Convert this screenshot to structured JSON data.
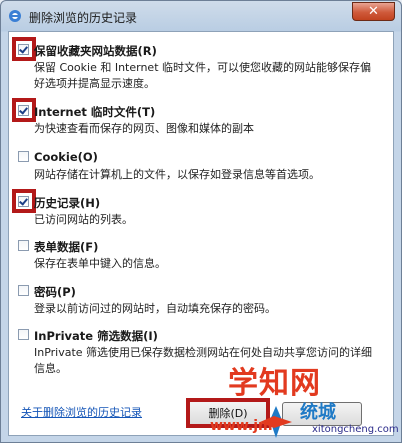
{
  "window": {
    "title": "删除浏览的历史记录",
    "close_glyph": "✕"
  },
  "options": [
    {
      "label": "保留收藏夹网站数据(R)",
      "checked": true,
      "highlighted": true,
      "description": "保留 Cookie 和 Internet 临时文件，可以使您收藏的网站能够保存偏好选项并提高显示速度。"
    },
    {
      "label": "Internet 临时文件(T)",
      "checked": true,
      "highlighted": true,
      "description": "为快速查看而保存的网页、图像和媒体的副本"
    },
    {
      "label": "Cookie(O)",
      "checked": false,
      "highlighted": false,
      "description": "网站存储在计算机上的文件，以保存如登录信息等首选项。"
    },
    {
      "label": "历史记录(H)",
      "checked": true,
      "highlighted": true,
      "description": "已访问网站的列表。"
    },
    {
      "label": "表单数据(F)",
      "checked": false,
      "highlighted": false,
      "description": "保存在表单中键入的信息。"
    },
    {
      "label": "密码(P)",
      "checked": false,
      "highlighted": false,
      "description": "登录以前访问过的网站时，自动填充保存的密码。"
    },
    {
      "label": "InPrivate 筛选数据(I)",
      "checked": false,
      "highlighted": false,
      "description": "InPrivate 筛选使用已保存数据检测网站在何处自动共享您访问的详细信息。"
    }
  ],
  "footer": {
    "help_link": "关于删除浏览的历史记录",
    "delete_label": "删除(D)",
    "cancel_label": ""
  },
  "watermark": {
    "line1": "学知网",
    "line2": "www.jm",
    "line3": "xitongcheng.com",
    "line4": "统城"
  },
  "colors": {
    "highlight": "#b31919",
    "link": "#1455b7",
    "watermark": "#e23a1f"
  }
}
